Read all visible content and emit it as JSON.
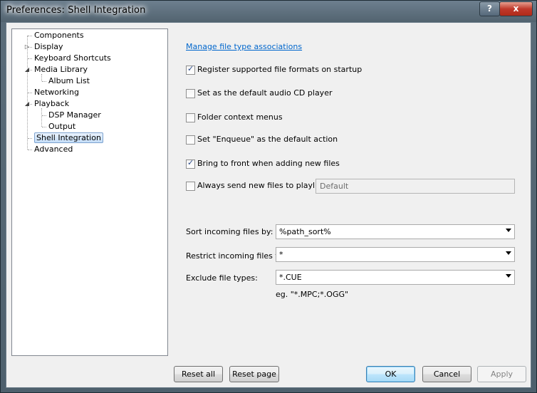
{
  "window": {
    "title": "Preferences: Shell Integration",
    "help_label": "?",
    "close_label": "x"
  },
  "tree": {
    "items": [
      {
        "label": "Components",
        "level": 1,
        "expander": ""
      },
      {
        "label": "Display",
        "level": 1,
        "expander": "collapsed"
      },
      {
        "label": "Keyboard Shortcuts",
        "level": 1,
        "expander": ""
      },
      {
        "label": "Media Library",
        "level": 1,
        "expander": "expanded"
      },
      {
        "label": "Album List",
        "level": 2,
        "expander": ""
      },
      {
        "label": "Networking",
        "level": 1,
        "expander": ""
      },
      {
        "label": "Playback",
        "level": 1,
        "expander": "expanded"
      },
      {
        "label": "DSP Manager",
        "level": 2,
        "expander": ""
      },
      {
        "label": "Output",
        "level": 2,
        "expander": ""
      },
      {
        "label": "Shell Integration",
        "level": 1,
        "expander": "",
        "selected": true
      },
      {
        "label": "Advanced",
        "level": 1,
        "expander": ""
      }
    ]
  },
  "page": {
    "link_label": "Manage file type associations",
    "options": [
      {
        "label": "Register supported file formats on startup",
        "checked": true
      },
      {
        "label": "Set as the default audio CD player",
        "checked": false
      },
      {
        "label": "Folder context menus",
        "checked": false
      },
      {
        "label": "Set \"Enqueue\" as the default action",
        "checked": false
      },
      {
        "label": "Bring to front when adding new files",
        "checked": true
      },
      {
        "label": "Always send new files to playlist:",
        "checked": false
      }
    ],
    "playlist_field_value": "Default",
    "sort_label": "Sort incoming files by:",
    "sort_value": "%path_sort%",
    "restrict_label": "Restrict incoming files to:",
    "restrict_value": "*",
    "exclude_label": "Exclude file types:",
    "exclude_value": "*.CUE",
    "exclude_hint": "eg. \"*.MPC;*.OGG\""
  },
  "buttons": {
    "reset_all": "Reset all",
    "reset_page": "Reset page",
    "ok": "OK",
    "cancel": "Cancel",
    "apply": "Apply"
  },
  "colors": {
    "link": "#0066cc",
    "check": "#2b4a8a",
    "close_button": "#c0392b"
  }
}
